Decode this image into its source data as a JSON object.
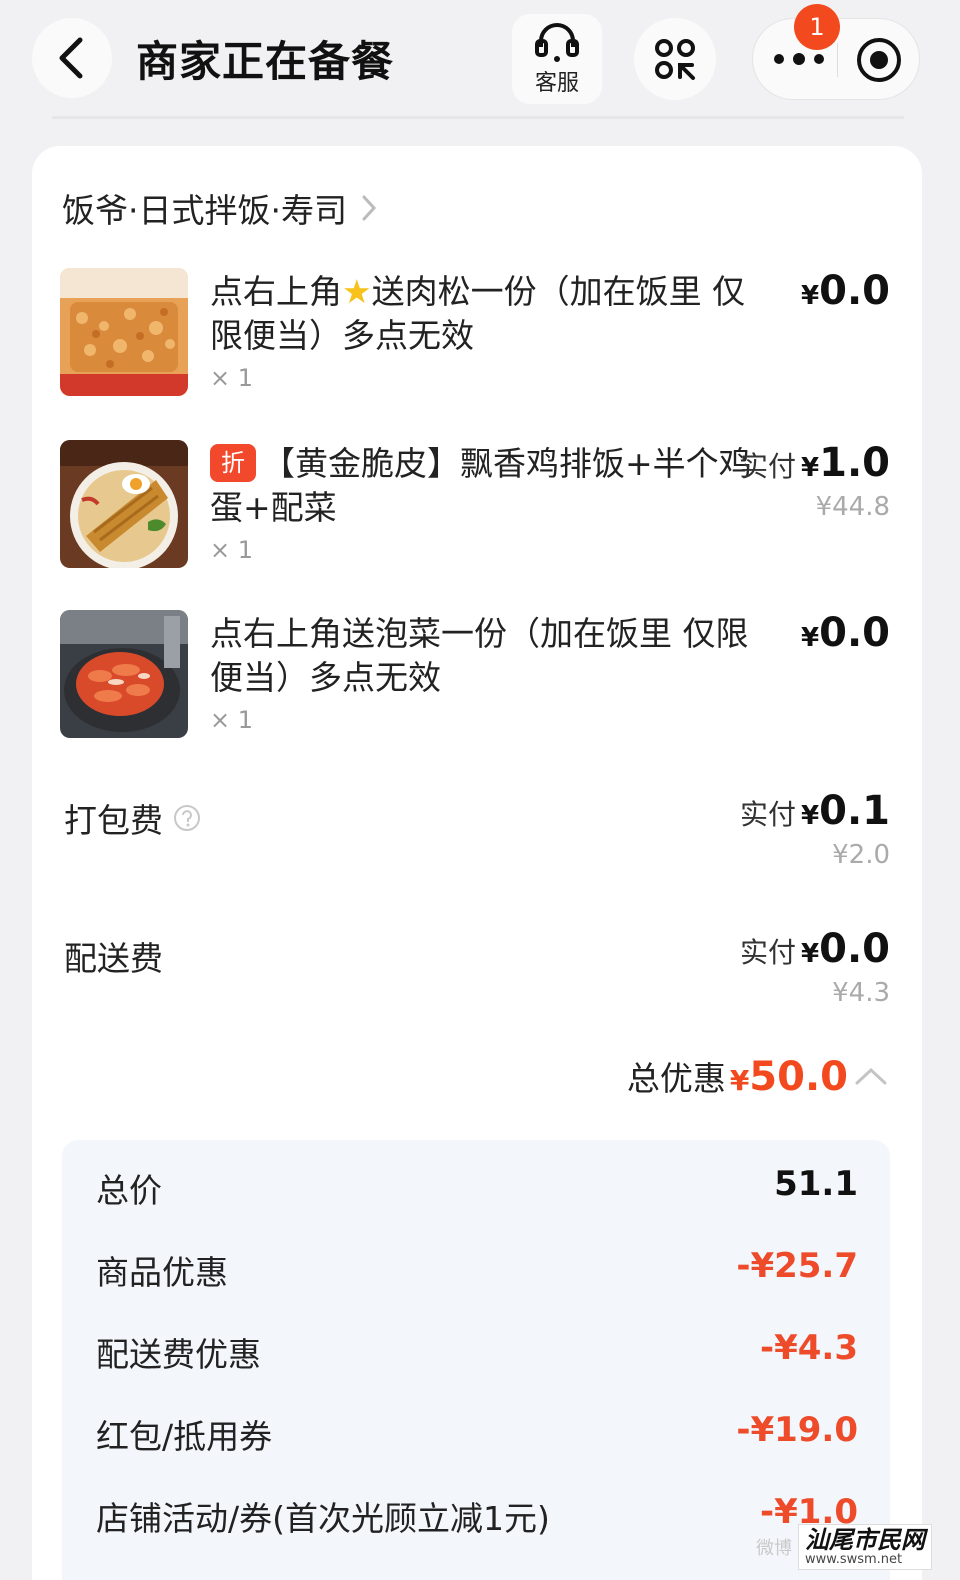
{
  "header": {
    "title": "商家正在备餐",
    "customer_service_label": "客服",
    "notification_count": "1"
  },
  "shop": {
    "name": "饭爷·日式拌饭·寿司"
  },
  "items": [
    {
      "name_part1": "点右上角",
      "name_star": "★",
      "name_part2": "送肉松一份（加在饭里 仅限便当）多点无效",
      "qty": "× 1",
      "price_prefix": "",
      "currency": "¥",
      "price": "0.0",
      "original_price": ""
    },
    {
      "tag": "折",
      "name": "【黄金脆皮】飘香鸡排饭+半个鸡蛋+配菜",
      "qty": "× 1",
      "price_prefix": "实付",
      "currency": "¥",
      "price": "1.0",
      "original_price": "¥44.8"
    },
    {
      "name": "点右上角送泡菜一份（加在饭里 仅限便当）多点无效",
      "qty": "× 1",
      "price_prefix": "",
      "currency": "¥",
      "price": "0.0",
      "original_price": ""
    }
  ],
  "fees": {
    "packing": {
      "label": "打包费",
      "price_prefix": "实付",
      "currency": "¥",
      "price": "0.1",
      "original_price": "¥2.0"
    },
    "delivery": {
      "label": "配送费",
      "price_prefix": "实付",
      "currency": "¥",
      "price": "0.0",
      "original_price": "¥4.3"
    }
  },
  "total_discount": {
    "label": "总优惠",
    "currency": "¥",
    "amount": "50.0"
  },
  "breakdown": [
    {
      "label": "总价",
      "value": "51.1"
    },
    {
      "label": "商品优惠",
      "value": "-¥25.7"
    },
    {
      "label": "配送费优惠",
      "value": "-¥4.3"
    },
    {
      "label": "红包/抵用券",
      "value": "-¥19.0"
    },
    {
      "label": "店铺活动/券(首次光顾立减1元)",
      "value": "-¥1.0"
    }
  ],
  "watermark": {
    "faint": "微博",
    "title": "汕尾市民网",
    "url": "www.swsm.net"
  },
  "colors": {
    "accent_red": "#ee4b2b",
    "badge_red": "#f24a1e",
    "breakdown_bg": "#f3f7fc",
    "star_yellow": "#f7c21c"
  }
}
